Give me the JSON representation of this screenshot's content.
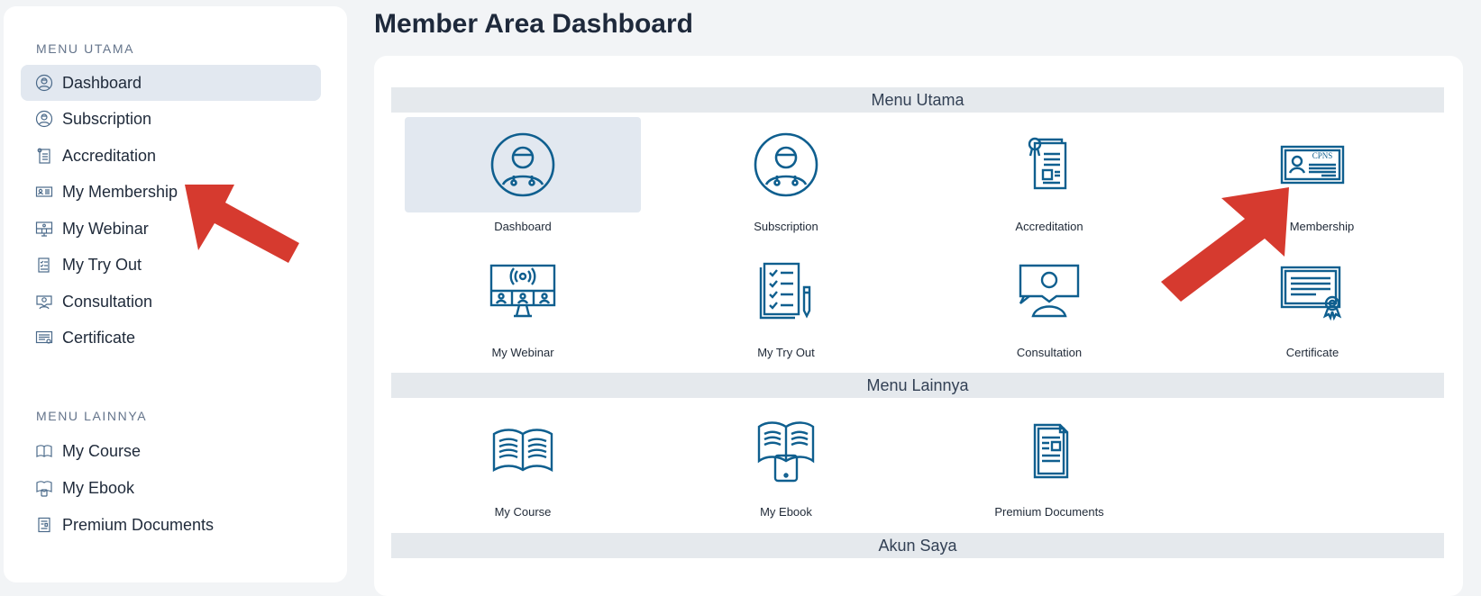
{
  "page_title": "Member Area Dashboard",
  "accent_color": "#0f5f8f",
  "sidebar": {
    "menu_utama_heading": "MENU UTAMA",
    "menu_lainnya_heading": "MENU LAINNYA",
    "items": [
      {
        "label": "Dashboard",
        "icon": "doctor-icon"
      },
      {
        "label": "Subscription",
        "icon": "doctor-icon"
      },
      {
        "label": "Accreditation",
        "icon": "accreditation-doc-icon"
      },
      {
        "label": "My Membership",
        "icon": "id-card-icon"
      },
      {
        "label": "My Webinar",
        "icon": "webinar-icon"
      },
      {
        "label": "My Try Out",
        "icon": "checklist-icon"
      },
      {
        "label": "Consultation",
        "icon": "consultation-icon"
      },
      {
        "label": "Certificate",
        "icon": "certificate-icon"
      }
    ],
    "other_items": [
      {
        "label": "My Course",
        "icon": "open-book-icon"
      },
      {
        "label": "My Ebook",
        "icon": "ebook-icon"
      },
      {
        "label": "Premium Documents",
        "icon": "document-icon"
      }
    ]
  },
  "main": {
    "sections": [
      "Menu Utama",
      "Menu Lainnya",
      "Akun Saya"
    ],
    "menu_utama_tiles": [
      {
        "label": "Dashboard",
        "icon": "doctor-icon"
      },
      {
        "label": "Subscription",
        "icon": "doctor-icon"
      },
      {
        "label": "Accreditation",
        "icon": "accreditation-doc-icon"
      },
      {
        "label": "My Membership",
        "icon": "id-card-icon",
        "card_text": "CPNS"
      },
      {
        "label": "My Webinar",
        "icon": "webinar-icon"
      },
      {
        "label": "My Try Out",
        "icon": "checklist-icon"
      },
      {
        "label": "Consultation",
        "icon": "consultation-icon"
      },
      {
        "label": "Certificate",
        "icon": "certificate-icon"
      }
    ],
    "menu_lainnya_tiles": [
      {
        "label": "My Course",
        "icon": "open-book-icon"
      },
      {
        "label": "My Ebook",
        "icon": "ebook-icon"
      },
      {
        "label": "Premium Documents",
        "icon": "document-icon"
      }
    ]
  },
  "annotation_color": "#d63a2f"
}
